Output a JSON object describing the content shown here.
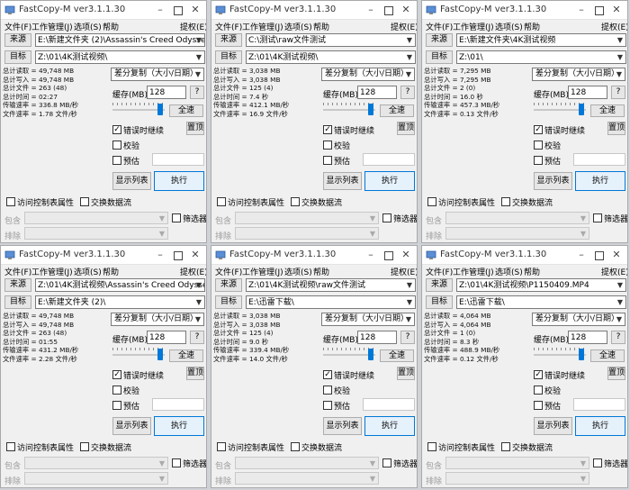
{
  "common": {
    "title": "FastCopy-M ver3.1.1.30",
    "menu": {
      "file": "文件(F)",
      "job": "工作管理(J)",
      "options": "选项(S)",
      "help": "帮助",
      "elevate": "提权(E)"
    },
    "source_button": "来源",
    "dest_button": "目标",
    "mode_label": "差分复制（大小/日期）",
    "buffer_label": "缓存(MB)",
    "buffer_value": "128",
    "help_button": "?",
    "full_speed_button": "全速",
    "verify_error_label": "错误时继续",
    "top_button": "置顶",
    "verify_label": "校验",
    "estimate_label": "预估",
    "list_button": "显示列表",
    "execute_button": "执行",
    "acl_label": "访问控制表属性",
    "stream_label": "交换数据流",
    "include_label": "包含",
    "exclude_label": "排除",
    "filter_label": "筛选器"
  },
  "windows": [
    {
      "source": "E:\\新建文件夹 (2)\\Assassin's Creed Odyssey",
      "dest": "Z:\\01\\4K测试视频\\",
      "stats": [
        "总计读取 = 49,748 MB",
        "总计写入 = 49,748 MB",
        "总计文件 = 263 (48)",
        "总计时间 = 02:27",
        "传输速率 = 336.8 MB/秒",
        "文件速率 = 1.78 文件/秒"
      ]
    },
    {
      "source": "C:\\测试\\raw文件测试",
      "dest": "Z:\\01\\4K测试视频\\",
      "stats": [
        "总计读取 = 3,038 MB",
        "总计写入 = 3,038 MB",
        "总计文件 = 125 (4)",
        "总计时间 = 7.4 秒",
        "传输速率 = 412.1 MB/秒",
        "文件速率 = 16.9 文件/秒"
      ]
    },
    {
      "source": "E:\\新建文件夹\\4K测试视频",
      "dest": "Z:\\01\\",
      "stats": [
        "总计读取 = 7,295 MB",
        "总计写入 = 7,295 MB",
        "总计文件 = 2 (0)",
        "总计时间 = 16.0 秒",
        "传输速率 = 457.3 MB/秒",
        "文件速率 = 0.13 文件/秒"
      ]
    },
    {
      "source": "Z:\\01\\4K测试视频\\Assassin's Creed Odyssey",
      "dest": "E:\\新建文件夹 (2)\\",
      "stats": [
        "总计读取 = 49,748 MB",
        "总计写入 = 49,748 MB",
        "总计文件 = 263 (48)",
        "总计时间 = 01:55",
        "传输速率 = 431.2 MB/秒",
        "文件速率 = 2.28 文件/秒"
      ]
    },
    {
      "source": "Z:\\01\\4K测试视频\\raw文件测试",
      "dest": "E:\\迅雷下载\\",
      "stats": [
        "总计读取 = 3,038 MB",
        "总计写入 = 3,038 MB",
        "总计文件 = 125 (4)",
        "总计时间 = 9.0 秒",
        "传输速率 = 339.4 MB/秒",
        "文件速率 = 14.0 文件/秒"
      ]
    },
    {
      "source": "Z:\\01\\4K测试视频\\P1150409.MP4",
      "dest": "E:\\迅雷下载\\",
      "stats": [
        "总计读取 = 4,064 MB",
        "总计写入 = 4,064 MB",
        "总计文件 = 1 (0)",
        "总计时间 = 8.3 秒",
        "传输速率 = 488.9 MB/秒",
        "文件速率 = 0.12 文件/秒"
      ]
    }
  ],
  "colors": {
    "accent": "#0078d7",
    "window_bg": "#f0f0f0"
  }
}
